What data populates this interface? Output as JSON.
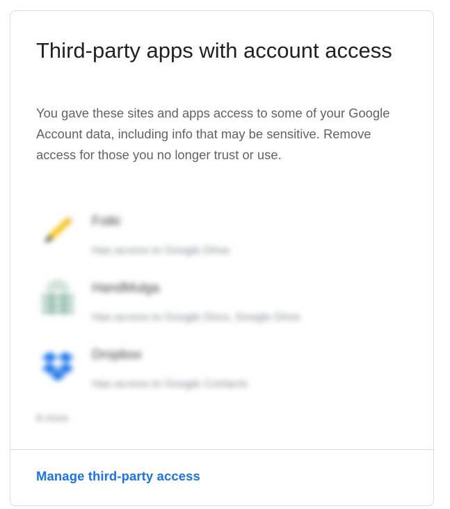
{
  "card": {
    "title": "Third-party apps with account access",
    "description": "You gave these sites and apps access to some of your Google Account data, including info that may be sensitive. Remove access for those you no longer trust or use.",
    "apps": [
      {
        "name": "Fotki",
        "access": "Has access to Google Drive",
        "icon": "pencil-icon",
        "icon_color": "#f4c20d"
      },
      {
        "name": "HandMulga",
        "access": "Has access to Google Docs, Google Drive",
        "icon": "grid-app-icon",
        "icon_color": "#6aa58c"
      },
      {
        "name": "Dropbox",
        "access": "Has access to Google Contacts",
        "icon": "dropbox-icon",
        "icon_color": "#1a73e8"
      }
    ],
    "more_label": "8 more",
    "manage_link": "Manage third-party access"
  },
  "colors": {
    "title": "#202124",
    "description": "#5f6368",
    "link": "#1a73e8",
    "border": "#dadce0"
  }
}
